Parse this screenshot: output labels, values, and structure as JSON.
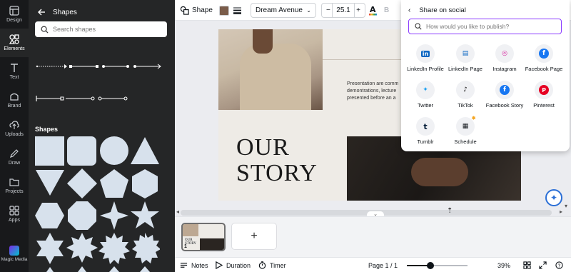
{
  "rail": {
    "items": [
      {
        "label": "Design"
      },
      {
        "label": "Elements"
      },
      {
        "label": "Text"
      },
      {
        "label": "Brand"
      },
      {
        "label": "Uploads"
      },
      {
        "label": "Draw"
      },
      {
        "label": "Projects"
      },
      {
        "label": "Apps"
      },
      {
        "label": "Magic Media"
      }
    ]
  },
  "panel": {
    "title": "Shapes",
    "search_placeholder": "Search shapes",
    "section_title": "Shapes"
  },
  "toolbar": {
    "shape_label": "Shape",
    "swatch_color": "#7a5c4a",
    "font_name": "Dream Avenue",
    "font_size": "25.1",
    "minus": "−",
    "plus": "+",
    "bold": "B"
  },
  "canvas": {
    "body_text": "Presentation are comm demontrations, lecture presented before an a",
    "headline_line1": "OUR",
    "headline_line2": "STORY"
  },
  "strip": {
    "thumb_text_1": "OUR",
    "thumb_text_2": "STORY",
    "page_number": "1",
    "add_label": "+"
  },
  "footer": {
    "notes": "Notes",
    "duration": "Duration",
    "timer": "Timer",
    "page_indicator": "Page 1 / 1",
    "zoom": "39%",
    "zoom_fraction": 0.39
  },
  "share": {
    "title": "Share on social",
    "search_placeholder": "How would you like to publish?",
    "items": [
      {
        "label": "LinkedIn Profile",
        "glyph": "in",
        "color": "#0a66c2"
      },
      {
        "label": "LinkedIn Page",
        "glyph": "▤",
        "color": "#0a66c2"
      },
      {
        "label": "Instagram",
        "glyph": "◎",
        "color": "#d6249f"
      },
      {
        "label": "Facebook Page",
        "glyph": "f",
        "color": "#1877f2"
      },
      {
        "label": "Twitter",
        "glyph": "✦",
        "color": "#1da1f2"
      },
      {
        "label": "TikTok",
        "glyph": "♪",
        "color": "#000000"
      },
      {
        "label": "Facebook Story",
        "glyph": "f",
        "color": "#1877f2"
      },
      {
        "label": "Pinterest",
        "glyph": "P",
        "color": "#e60023"
      },
      {
        "label": "Tumblr",
        "glyph": "t",
        "color": "#001935"
      },
      {
        "label": "Schedule",
        "glyph": "▦",
        "color": "#0e1318"
      }
    ]
  }
}
